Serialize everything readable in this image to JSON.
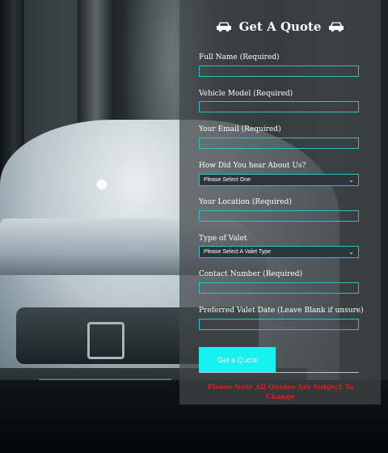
{
  "form": {
    "title": "Get A Quote",
    "title_icon": "car-icon",
    "fields": [
      {
        "label": "Full Name (Required)",
        "value": ""
      },
      {
        "label": "Vehicle Model (Required)",
        "value": ""
      },
      {
        "label": "Your Email (Required)",
        "value": ""
      },
      {
        "label": "How Did You hear About Us?",
        "selected": "Please Select One"
      },
      {
        "label": "Your Location (Required)",
        "value": ""
      },
      {
        "label": "Type of Valet",
        "selected": "Please Select A Valet Type"
      },
      {
        "label": "Contact Number (Required)",
        "value": ""
      },
      {
        "label": "Preferred Valet Date (Leave Blank if unsure)",
        "value": ""
      }
    ],
    "submit_label": "Get a Quote",
    "note": "Please Note All Quotes Are Subject To Change"
  },
  "colors": {
    "accent": "#17f2f0",
    "input_border": "#2fbfc7",
    "note": "#e51c1c"
  }
}
